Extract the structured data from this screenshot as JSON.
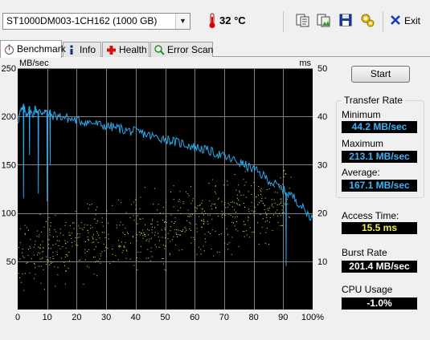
{
  "toolbar": {
    "drive": "ST1000DM003-1CH162 (1000 GB)",
    "temperature": "32 °C",
    "icons": [
      "thermometer-icon",
      "copy-text-icon",
      "copy-image-icon",
      "save-icon",
      "options-icon",
      "exit-icon"
    ],
    "exit_label": "Exit"
  },
  "tabs": [
    {
      "label": "Benchmark",
      "icon": "stopwatch-icon",
      "active": true
    },
    {
      "label": "Info",
      "icon": "info-icon",
      "active": false
    },
    {
      "label": "Health",
      "icon": "health-cross-icon",
      "active": false
    },
    {
      "label": "Error Scan",
      "icon": "magnifier-icon",
      "active": false
    }
  ],
  "panel": {
    "start_label": "Start",
    "transfer_rate_title": "Transfer Rate",
    "minimum_label": "Minimum",
    "minimum_value": "44.2 MB/sec",
    "maximum_label": "Maximum",
    "maximum_value": "213.1 MB/sec",
    "average_label": "Average:",
    "average_value": "167.1 MB/sec",
    "access_time_label": "Access Time:",
    "access_time_value": "15.5 ms",
    "burst_rate_label": "Burst Rate",
    "burst_rate_value": "201.4 MB/sec",
    "cpu_usage_label": "CPU Usage",
    "cpu_usage_value": "-1.0%"
  },
  "colors": {
    "chart_bg": "#000000",
    "grid": "#7f7f7f",
    "transfer_line": "#2aa8ee",
    "access_dots": "#e8e84a",
    "transfer_values": "#3cb4f8",
    "access_value": "#f0f050",
    "white_values": "#ffffff"
  },
  "chart_data": {
    "type": "line",
    "left_unit": "MB/sec",
    "right_unit": "ms",
    "left_ticks": [
      "250",
      "200",
      "150",
      "100",
      "50"
    ],
    "right_ticks": [
      "50",
      "40",
      "30",
      "20",
      "10"
    ],
    "x_ticks": [
      "0",
      "10",
      "20",
      "30",
      "40",
      "50",
      "60",
      "70",
      "80",
      "90",
      "100%"
    ],
    "ylim_left": [
      0,
      250
    ],
    "ylim_right": [
      0,
      50
    ],
    "xlim": [
      0,
      100
    ],
    "grid": true,
    "series": [
      {
        "axis": "left",
        "x": [
          0,
          1,
          2,
          3,
          4,
          5,
          6,
          7,
          8,
          9,
          10,
          12,
          14,
          16,
          18,
          20,
          22,
          24,
          26,
          28,
          30,
          32,
          34,
          36,
          38,
          40,
          42,
          44,
          46,
          48,
          50,
          52,
          54,
          56,
          58,
          60,
          62,
          64,
          66,
          68,
          70,
          72,
          74,
          76,
          78,
          80,
          82,
          84,
          86,
          88,
          90,
          92,
          94,
          96,
          98,
          100
        ],
        "y": [
          195,
          205,
          208,
          203,
          207,
          201,
          208,
          205,
          204,
          206,
          203,
          201,
          200,
          199,
          197,
          196,
          195,
          194,
          193,
          191,
          190,
          189,
          188,
          186,
          185,
          184,
          183,
          181,
          179,
          178,
          177,
          175,
          173,
          172,
          170,
          168,
          167,
          165,
          163,
          161,
          158,
          156,
          154,
          151,
          148,
          145,
          141,
          137,
          132,
          128,
          124,
          120,
          115,
          108,
          100,
          95
        ]
      },
      {
        "axis": "left",
        "type": "dips",
        "x": [
          2,
          4,
          7,
          10,
          11,
          91,
          92
        ],
        "y": [
          115,
          160,
          120,
          112,
          150,
          45,
          120
        ]
      },
      {
        "axis": "right",
        "type": "scatter",
        "x_range": [
          0,
          93
        ],
        "mean_start": 11,
        "mean_end": 22.5,
        "spread": 3.5
      }
    ]
  }
}
